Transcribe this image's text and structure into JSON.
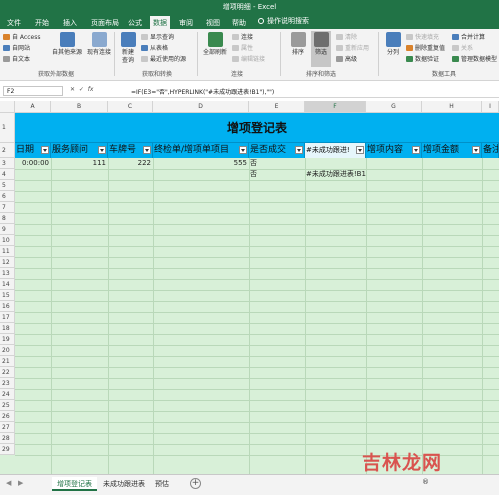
{
  "window": {
    "title": "增项明细 - Excel"
  },
  "menu": {
    "tabs": [
      "文件",
      "开始",
      "插入",
      "页面布局",
      "公式",
      "数据",
      "审阅",
      "视图",
      "帮助"
    ],
    "active": "数据",
    "tell_me": "操作说明搜索"
  },
  "ribbon": {
    "get_external": {
      "access": "自 Access",
      "web": "自网站",
      "text": "自文本",
      "other": "自其他来源",
      "existing": "现有连接",
      "label": "获取外部数据"
    },
    "get_transform": {
      "new_query": "新建\n查询",
      "show_queries": "显示查询",
      "from_table": "从表格",
      "recent_sources": "最近使用的源",
      "label": "获取和转换"
    },
    "connections": {
      "refresh_all": "全部刷新",
      "connections": "连接",
      "properties": "属性",
      "edit_links": "编辑链接",
      "label": "连接"
    },
    "sort_filter": {
      "sort": "排序",
      "filter": "筛选",
      "clear": "清除",
      "reapply": "重新应用",
      "advanced": "高级",
      "label": "排序和筛选"
    },
    "data_tools": {
      "text_to_columns": "分列",
      "flash_fill": "快速填充",
      "remove_duplicates": "删除重复值",
      "validation": "数据验证",
      "consolidate": "合并计算",
      "relationships": "关系",
      "manage_model": "管理数据模型",
      "label": "数据工具"
    }
  },
  "formula_bar": {
    "name_box": "F2",
    "formula": "=IF(E3=\"否\",HYPERLINK(\"#未成功跟进表!B1\"),\"\")"
  },
  "sheet": {
    "columns": [
      "A",
      "B",
      "C",
      "D",
      "E",
      "F",
      "G",
      "H",
      "I"
    ],
    "selected_column": "F",
    "rows": [
      "1",
      "2",
      "3",
      "4",
      "5",
      "6",
      "7",
      "8",
      "9",
      "10",
      "11",
      "12",
      "13",
      "14",
      "15",
      "16",
      "17",
      "18",
      "19",
      "20",
      "21",
      "22",
      "23",
      "24",
      "25",
      "26",
      "27",
      "28",
      "29"
    ],
    "banner": "增项登记表",
    "headers": [
      "日期",
      "服务顾问",
      "车牌号",
      "终检单/增项单项目",
      "是否成交",
      "#未成功跟进!",
      "增项内容",
      "增项金额",
      "备注"
    ],
    "row3": {
      "date": "0:00:00",
      "advisor": "111",
      "plate": "222",
      "item": "555",
      "deal": "否"
    },
    "row4": {
      "deal": "否",
      "link": "#未成功跟进表!B1"
    }
  },
  "sheet_tabs": {
    "tabs": [
      "增项登记表",
      "未成功跟进表",
      "预估"
    ],
    "active": "增项登记表"
  },
  "watermark": {
    "text": "吉林龙网",
    "small": "®"
  }
}
